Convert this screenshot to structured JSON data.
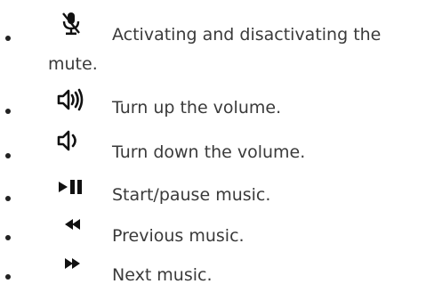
{
  "controls": [
    {
      "icon": "mute-microphone-icon",
      "text": "Activating and disactivating the",
      "text_cont": "mute."
    },
    {
      "icon": "volume-up-icon",
      "text": "Turn up the volume."
    },
    {
      "icon": "volume-down-icon",
      "text": "Turn down the volume."
    },
    {
      "icon": "play-pause-icon",
      "text": "Start/pause music."
    },
    {
      "icon": "previous-icon",
      "text": "Previous music."
    },
    {
      "icon": "next-icon",
      "text": "Next music."
    }
  ],
  "colors": {
    "text": "#3a3a3a",
    "icon": "#111111",
    "bullet": "#222222"
  }
}
